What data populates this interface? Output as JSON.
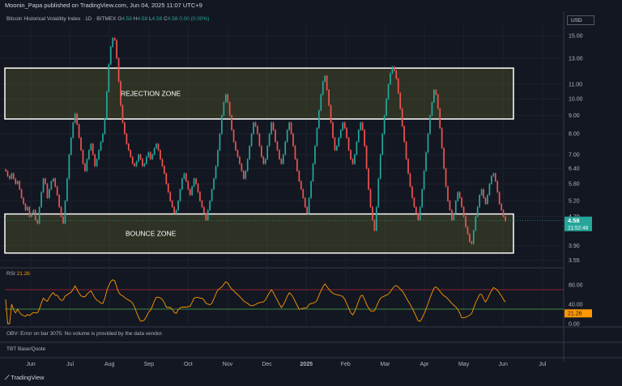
{
  "header": {
    "published": "Moonin_Papa published on TradingView.com, Jun 04, 2025 11:07 UTC+9"
  },
  "legend": {
    "symbol": "Bitcoin Historical Volatility Index · 1D · BITMEX",
    "o_label": "O",
    "o": "4.58",
    "h_label": "H",
    "h": "4.58",
    "l_label": "L",
    "l": "4.58",
    "c_label": "C",
    "c": "4.58",
    "change": "0.00 (0.00%)"
  },
  "currency": "USD",
  "colors": {
    "up": "#26a69a",
    "down": "#ef5350",
    "rsi": "#ff9800",
    "bg": "#131722"
  },
  "chart_data": [
    {
      "type": "candlestick",
      "yaxis_ticks": [
        15.0,
        13.0,
        11.0,
        10.0,
        9.0,
        8.0,
        7.0,
        6.4,
        5.8,
        5.2,
        4.7,
        3.9,
        3.55
      ],
      "ylim": [
        3.4,
        16.0
      ],
      "log_scale": true,
      "xaxis_ticks": [
        "Jun",
        "Jul",
        "Aug",
        "Sep",
        "Oct",
        "Nov",
        "Dec",
        "2025",
        "Feb",
        "Mar",
        "Apr",
        "May",
        "Jun",
        "Jul"
      ],
      "last_price": "4.58",
      "countdown": "21:52:48",
      "grid": true,
      "zones": [
        {
          "label": "REJECTION ZONE",
          "top": 12.2,
          "bottom": 8.8
        },
        {
          "label": "BOUNCE ZONE",
          "top": 4.78,
          "bottom": 3.72
        }
      ],
      "close": [
        6.3,
        6.1,
        6.0,
        6.2,
        6.0,
        5.8,
        5.9,
        5.6,
        5.3,
        5.1,
        4.9,
        5.0,
        4.7,
        4.8,
        4.9,
        4.6,
        4.5,
        5.0,
        5.5,
        6.0,
        5.8,
        5.3,
        5.6,
        5.9,
        6.0,
        5.7,
        5.4,
        5.0,
        4.7,
        4.5,
        5.2,
        6.0,
        7.0,
        7.8,
        8.6,
        9.1,
        8.5,
        7.8,
        7.2,
        6.6,
        6.3,
        6.8,
        7.2,
        7.5,
        7.0,
        6.5,
        6.8,
        7.2,
        7.6,
        8.0,
        8.8,
        10.5,
        12.5,
        14.0,
        14.8,
        14.6,
        13.0,
        11.2,
        9.6,
        8.6,
        8.0,
        7.5,
        7.2,
        6.9,
        6.6,
        6.5,
        6.7,
        7.0,
        6.8,
        6.5,
        6.6,
        6.9,
        7.1,
        6.8,
        7.0,
        7.3,
        7.5,
        7.2,
        6.8,
        6.5,
        6.2,
        5.8,
        5.5,
        5.2,
        5.0,
        4.8,
        4.9,
        5.2,
        5.6,
        6.0,
        6.2,
        5.9,
        5.6,
        5.4,
        5.7,
        6.0,
        5.8,
        5.5,
        5.2,
        5.0,
        4.8,
        4.6,
        4.9,
        5.2,
        5.6,
        6.0,
        6.5,
        7.2,
        8.0,
        9.0,
        9.8,
        10.3,
        9.8,
        9.0,
        8.2,
        7.6,
        7.2,
        6.9,
        6.6,
        6.3,
        6.0,
        6.3,
        6.8,
        7.4,
        8.0,
        8.6,
        8.4,
        8.0,
        7.4,
        6.9,
        6.6,
        6.8,
        7.4,
        8.0,
        8.6,
        8.2,
        7.6,
        7.2,
        6.8,
        6.6,
        7.0,
        7.6,
        8.2,
        8.6,
        8.0,
        7.4,
        6.8,
        6.3,
        5.9,
        5.6,
        5.3,
        5.0,
        4.8,
        5.3,
        5.9,
        6.6,
        7.4,
        8.3,
        9.3,
        10.3,
        11.2,
        11.6,
        10.6,
        9.6,
        8.6,
        7.8,
        7.2,
        7.4,
        7.8,
        8.2,
        8.6,
        8.3,
        7.8,
        7.2,
        6.8,
        6.6,
        7.0,
        7.6,
        8.2,
        8.6,
        8.2,
        7.4,
        6.4,
        5.6,
        5.0,
        4.6,
        4.3,
        5.0,
        6.0,
        7.0,
        8.0,
        9.0,
        10.0,
        11.0,
        11.8,
        12.3,
        12.0,
        11.4,
        10.4,
        9.4,
        8.4,
        7.6,
        6.8,
        6.2,
        5.7,
        5.3,
        5.0,
        4.8,
        4.6,
        5.0,
        5.6,
        6.3,
        7.1,
        8.0,
        9.0,
        9.8,
        10.6,
        10.3,
        9.4,
        8.3,
        7.3,
        6.4,
        5.7,
        5.2,
        4.9,
        4.6,
        4.8,
        5.2,
        5.5,
        5.3,
        5.0,
        4.7,
        4.4,
        4.2,
        4.0,
        3.95,
        4.3,
        4.7,
        5.0,
        5.4,
        5.6,
        5.3,
        5.1,
        5.4,
        5.8,
        6.1,
        6.2,
        5.9,
        5.5,
        5.1,
        4.9,
        4.7,
        4.58
      ]
    },
    {
      "type": "line",
      "name": "RSI",
      "value_label": "21.26",
      "ylim": [
        0,
        100
      ],
      "yaxis_ticks": [
        80.0,
        40.0,
        0.0
      ],
      "levels": [
        70,
        30
      ],
      "last_value": "21.26"
    }
  ],
  "panes": {
    "rsi_label": "RSI",
    "rsi_value": "21.26",
    "obv_label": "OBV: Error on bar 3075: No volume is provided by the data vendor.",
    "tbt_label": "TBT Base/Quote"
  },
  "footer": {
    "brand": "TradingView"
  }
}
